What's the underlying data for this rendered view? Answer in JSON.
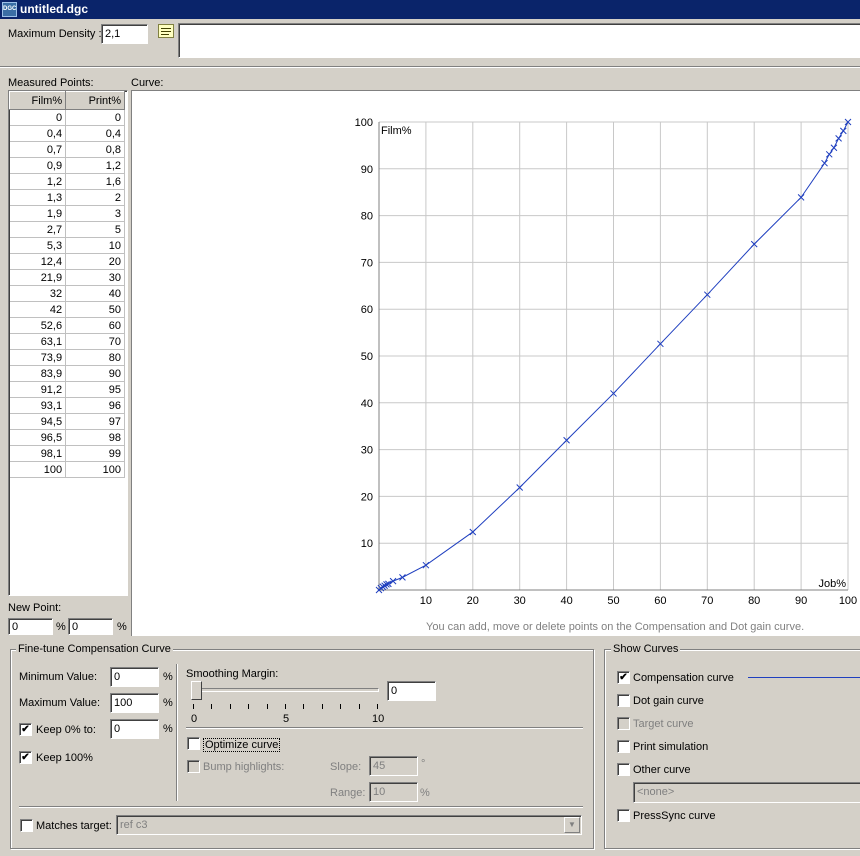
{
  "window": {
    "title": "untitled.dgc",
    "icon": "DGC"
  },
  "top": {
    "max_density_label": "Maximum Density :",
    "max_density_value": "2,1",
    "comment_value": ""
  },
  "measured_points": {
    "label": "Measured Points:",
    "columns": [
      "Film%",
      "Print%"
    ],
    "rows": [
      [
        "0",
        "0"
      ],
      [
        "0,4",
        "0,4"
      ],
      [
        "0,7",
        "0,8"
      ],
      [
        "0,9",
        "1,2"
      ],
      [
        "1,2",
        "1,6"
      ],
      [
        "1,3",
        "2"
      ],
      [
        "1,9",
        "3"
      ],
      [
        "2,7",
        "5"
      ],
      [
        "5,3",
        "10"
      ],
      [
        "12,4",
        "20"
      ],
      [
        "21,9",
        "30"
      ],
      [
        "32",
        "40"
      ],
      [
        "42",
        "50"
      ],
      [
        "52,6",
        "60"
      ],
      [
        "63,1",
        "70"
      ],
      [
        "73,9",
        "80"
      ],
      [
        "83,9",
        "90"
      ],
      [
        "91,2",
        "95"
      ],
      [
        "93,1",
        "96"
      ],
      [
        "94,5",
        "97"
      ],
      [
        "96,5",
        "98"
      ],
      [
        "98,1",
        "99"
      ],
      [
        "100",
        "100"
      ]
    ]
  },
  "new_point": {
    "label": "New Point:",
    "film_value": "0",
    "print_value": "0",
    "unit": "%"
  },
  "curve": {
    "label": "Curve:",
    "hint": "You can add, move or delete points on the Compensation and Dot gain curve."
  },
  "chart_data": {
    "type": "line",
    "title": "",
    "xlabel": "Job%",
    "ylabel": "Film%",
    "xlim": [
      0,
      100
    ],
    "ylim": [
      0,
      100
    ],
    "xticks": [
      "10",
      "20",
      "30",
      "40",
      "50",
      "60",
      "70",
      "80",
      "90",
      "100"
    ],
    "yticks": [
      "10",
      "20",
      "30",
      "40",
      "50",
      "60",
      "70",
      "80",
      "90",
      "100"
    ],
    "grid": true,
    "line_color": "#1f3fbf",
    "series": [
      {
        "x": [
          0,
          0.4,
          0.8,
          1.2,
          1.6,
          2,
          3,
          5,
          10,
          20,
          30,
          40,
          50,
          60,
          70,
          80,
          90,
          95,
          96,
          97,
          98,
          99,
          100
        ],
        "y": [
          0,
          0.4,
          0.7,
          0.9,
          1.2,
          1.3,
          1.9,
          2.7,
          5.3,
          12.4,
          21.9,
          32,
          42,
          52.6,
          63.1,
          73.9,
          83.9,
          91.2,
          93.1,
          94.5,
          96.5,
          98.1,
          100
        ]
      }
    ]
  },
  "finetune": {
    "title": "Fine-tune Compensation Curve",
    "min_label": "Minimum Value:",
    "min_value": "0",
    "max_label": "Maximum Value:",
    "max_value": "100",
    "keep0_label": "Keep 0% to:",
    "keep0_value": "0",
    "keep100_label": "Keep 100%",
    "pct": "%",
    "smoothing_label": "Smoothing Margin:",
    "smoothing_value": "0",
    "smoothing_fraction": 0,
    "scale_labels": [
      "0",
      "5",
      "10"
    ],
    "optimize_label": "Optimize curve",
    "bump_label": "Bump highlights:",
    "slope_label": "Slope:",
    "slope_value": "45",
    "slope_unit": "°",
    "range_label": "Range:",
    "range_value": "10",
    "range_unit": "%",
    "matches_label": "Matches target:",
    "matches_value": "ref c3"
  },
  "show_curves": {
    "title": "Show Curves",
    "items": [
      {
        "label": "Compensation curve",
        "checked": true,
        "disabled": false
      },
      {
        "label": "Dot gain curve",
        "checked": false,
        "disabled": false
      },
      {
        "label": "Target curve",
        "checked": false,
        "disabled": true
      },
      {
        "label": "Print simulation",
        "checked": false,
        "disabled": false
      },
      {
        "label": "Other curve",
        "checked": false,
        "disabled": false
      }
    ],
    "other_select": "<none>",
    "presssync_label": "PressSync curve",
    "compensation_line_color": "#1f3fbf"
  }
}
